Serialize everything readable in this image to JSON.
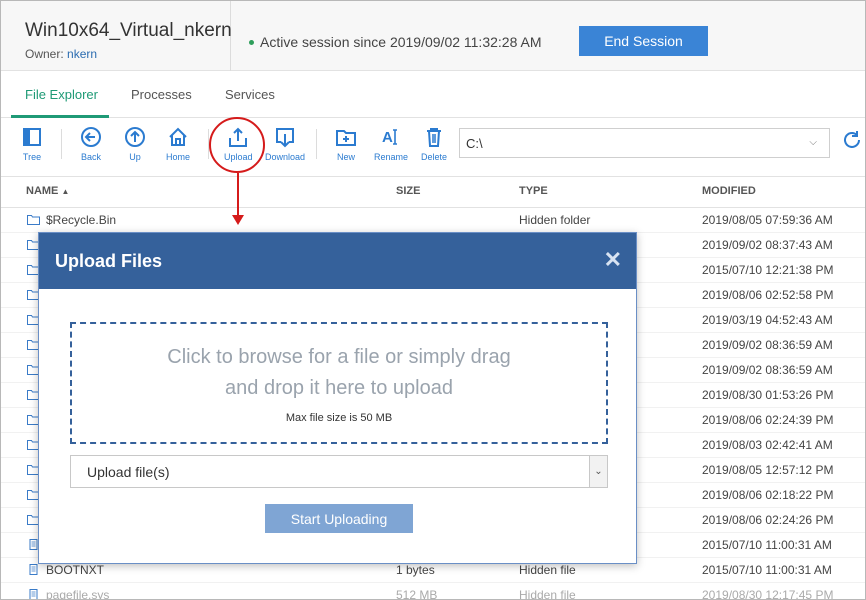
{
  "header": {
    "device_name": "Win10x64_Virtual_nkern",
    "owner_label": "Owner:",
    "owner_value": "nkern",
    "session_status": "Active session since 2019/09/02 11:32:28 AM",
    "end_session_label": "End Session"
  },
  "tabs": [
    {
      "label": "File Explorer",
      "active": true
    },
    {
      "label": "Processes",
      "active": false
    },
    {
      "label": "Services",
      "active": false
    }
  ],
  "toolbar": {
    "tree": "Tree",
    "back": "Back",
    "up": "Up",
    "home": "Home",
    "upload": "Upload",
    "download": "Download",
    "new": "New",
    "rename": "Rename",
    "delete": "Delete",
    "path": "C:\\"
  },
  "columns": {
    "name": "NAME",
    "size": "SIZE",
    "type": "TYPE",
    "modified": "MODIFIED"
  },
  "rows": [
    {
      "name": "$Recycle.Bin",
      "size": "",
      "type": "Hidden folder",
      "modified": "2019/08/05 07:59:36 AM",
      "icon": "folder-icon"
    },
    {
      "name": "",
      "size": "",
      "type": "",
      "modified": "2019/09/02 08:37:43 AM",
      "icon": "folder-icon"
    },
    {
      "name": "",
      "size": "",
      "type": "",
      "modified": "2015/07/10 12:21:38 PM",
      "icon": "folder-icon"
    },
    {
      "name": "",
      "size": "",
      "type": "",
      "modified": "2019/08/06 02:52:58 PM",
      "icon": "folder-icon"
    },
    {
      "name": "",
      "size": "",
      "type": "",
      "modified": "2019/03/19 04:52:43 AM",
      "icon": "folder-icon"
    },
    {
      "name": "",
      "size": "",
      "type": "",
      "modified": "2019/09/02 08:36:59 AM",
      "icon": "folder-icon"
    },
    {
      "name": "",
      "size": "",
      "type": "",
      "modified": "2019/09/02 08:36:59 AM",
      "icon": "folder-icon"
    },
    {
      "name": "",
      "size": "",
      "type": "",
      "modified": "2019/08/30 01:53:26 PM",
      "icon": "folder-icon"
    },
    {
      "name": "",
      "size": "",
      "type": "",
      "modified": "2019/08/06 02:24:39 PM",
      "icon": "folder-icon"
    },
    {
      "name": "",
      "size": "",
      "type": "",
      "modified": "2019/08/03 02:42:41 AM",
      "icon": "folder-icon"
    },
    {
      "name": "",
      "size": "",
      "type": "",
      "modified": "2019/08/05 12:57:12 PM",
      "icon": "folder-icon"
    },
    {
      "name": "",
      "size": "",
      "type": "",
      "modified": "2019/08/06 02:18:22 PM",
      "icon": "folder-icon"
    },
    {
      "name": "",
      "size": "",
      "type": "",
      "modified": "2019/08/06 02:24:26 PM",
      "icon": "folder-icon"
    },
    {
      "name": "",
      "size": "",
      "type": "",
      "modified": "2015/07/10 11:00:31 AM",
      "icon": "file-icon"
    },
    {
      "name": "BOOTNXT",
      "size": "1 bytes",
      "type": "Hidden file",
      "modified": "2015/07/10 11:00:31 AM",
      "icon": "file-icon"
    },
    {
      "name": "pagefile.sys",
      "size": "512 MB",
      "type": "Hidden file",
      "modified": "2019/08/30 12:17:45 PM",
      "icon": "file-icon",
      "muted": true
    }
  ],
  "modal": {
    "title": "Upload Files",
    "drop_line1": "Click to browse for a file or simply drag",
    "drop_line2": "and drop it here to upload",
    "max_size": "Max file size is 50 MB",
    "select_value": "Upload file(s)",
    "start_label": "Start Uploading"
  },
  "colors": {
    "accent": "#1f9a76",
    "primary": "#3a84d6",
    "modal_header": "#35619b",
    "highlight": "#d51b1b"
  }
}
